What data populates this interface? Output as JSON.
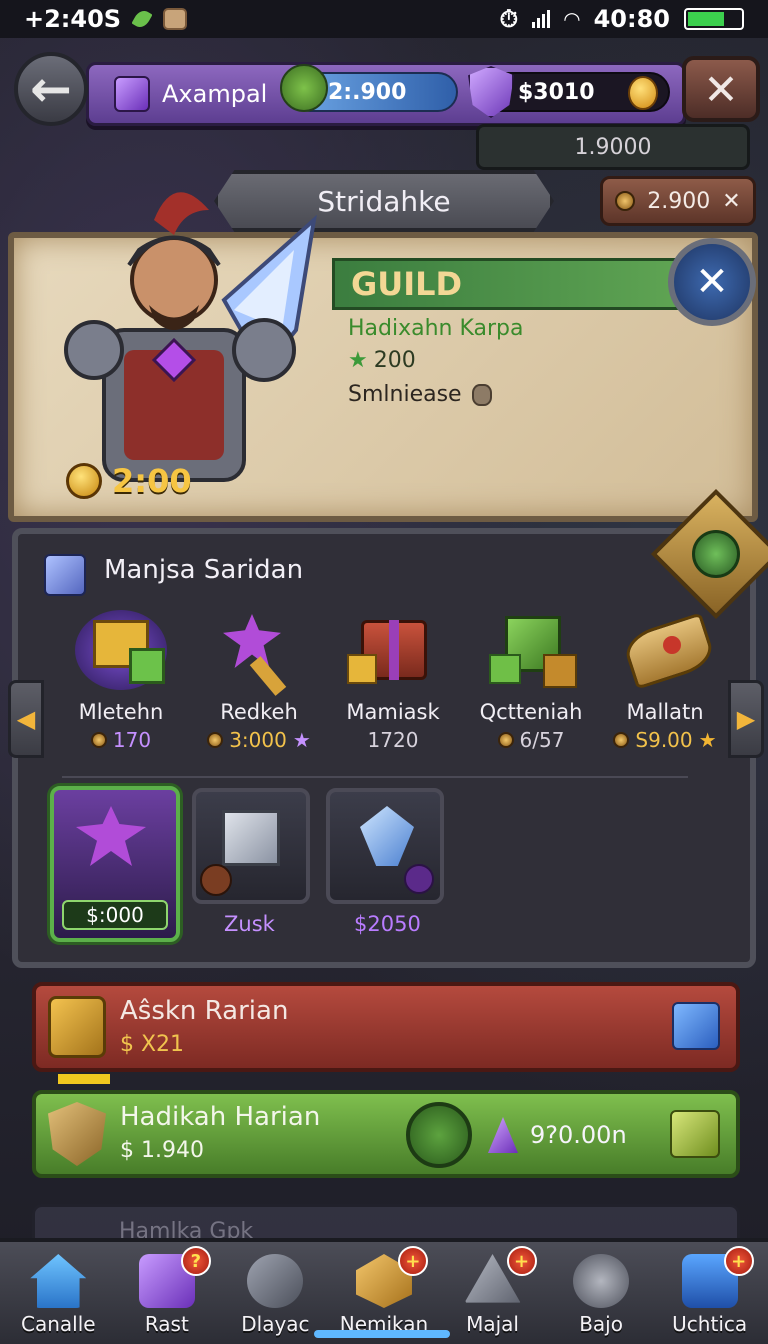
{
  "status_bar": {
    "time": "+2:40S",
    "clock": "40:80"
  },
  "top_banner": {
    "player_name": "Axampal",
    "energy_value": "2:.900",
    "gold_value": "$3010",
    "sub_value": "1.9000"
  },
  "screen_title": "Stridahke",
  "side_chip_value": "2.900",
  "hero": {
    "guild_label": "GUILD",
    "guild_name": "Hadixahn Karpa",
    "stars": "200",
    "status": "Smlniease",
    "cost": "2:00"
  },
  "shop": {
    "title": "Manjsa Saridan",
    "items": [
      {
        "name": "Mletehn",
        "price": "170"
      },
      {
        "name": "Redkeh",
        "price": "3:000"
      },
      {
        "name": "Mamiask",
        "price": "1720"
      },
      {
        "name": "Qctteniah",
        "price": "6/57"
      },
      {
        "name": "Mallatn",
        "price": "S9.00"
      }
    ],
    "cards": [
      {
        "price": "$:000"
      },
      {
        "label": "Zusk"
      },
      {
        "label": "$2050"
      }
    ]
  },
  "rows": [
    {
      "title": "Aŝskn Rarian",
      "value": "$ X21"
    },
    {
      "title": "Hadikah Harian",
      "value": "$ 1.940",
      "cost": "9?0.00n"
    },
    {
      "title": "Hamlka Gpk"
    }
  ],
  "nav": [
    {
      "label": "Canalle",
      "badge": ""
    },
    {
      "label": "Rast",
      "badge": "?"
    },
    {
      "label": "Dlayac",
      "badge": ""
    },
    {
      "label": "Nemikan",
      "badge": "+"
    },
    {
      "label": "Majal",
      "badge": "+"
    },
    {
      "label": "Bajo",
      "badge": ""
    },
    {
      "label": "Uchtica",
      "badge": "+"
    }
  ],
  "colors": {
    "accent_purple": "#8d68bf",
    "accent_green": "#5fa453",
    "accent_red": "#b54a3e",
    "gold": "#f2c24b"
  }
}
